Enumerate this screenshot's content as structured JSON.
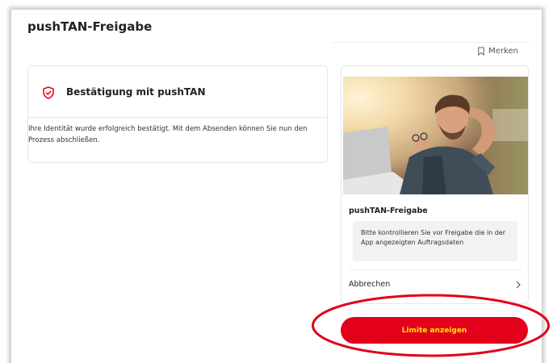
{
  "page": {
    "title": "pushTAN-Freigabe",
    "merken_label": "Merken"
  },
  "confirmation_card": {
    "title": "Bestätigung mit pushTAN",
    "body": "Ihre Identität wurde erfolgreich bestätigt. Mit dem Absenden können Sie nun den Prozess abschließen.",
    "icon": "shield-check-icon"
  },
  "side_card": {
    "image": "man-relaxing-at-desk-photo",
    "title": "pushTAN-Freigabe",
    "info": "Bitte kontrollieren Sie vor Freigabe die in der App angezeigten Auftragsdaten",
    "cancel_label": "Abbrechen"
  },
  "actions": {
    "limit_button_label": "Limite anzeigen"
  },
  "colors": {
    "brand_red": "#e2001a",
    "button_text": "#ffe900",
    "annotation_red": "#e0001a"
  }
}
